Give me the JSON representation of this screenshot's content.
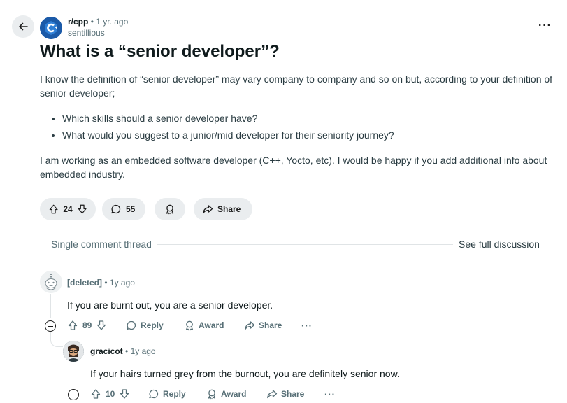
{
  "post": {
    "subreddit": "r/cpp",
    "age": "1 yr. ago",
    "separator": "•",
    "author": "sentillious",
    "subreddit_avatar_letter": "C",
    "title": "What is a “senior developer”?",
    "paragraph1": "I know the definition of “senior developer” may vary company to company and so on but, according to your definition of senior developer;",
    "bullets": [
      "Which skills should a senior developer have?",
      "What would you suggest to a junior/mid developer for their seniority journey?"
    ],
    "paragraph2": "I am working as an embedded software developer (C++, Yocto, etc). I would be happy if you add additional info about embedded industry.",
    "score": "24",
    "comment_count": "55",
    "share_label": "Share",
    "more_icon": "···"
  },
  "thread": {
    "label": "Single comment thread",
    "see_full": "See full discussion"
  },
  "comments": [
    {
      "author": "[deleted]",
      "age": "1y ago",
      "text": "If you are burnt out, you are a senior developer.",
      "score": "89",
      "reply_label": "Reply",
      "award_label": "Award",
      "share_label": "Share",
      "more_icon": "···"
    },
    {
      "author": "gracicot",
      "age": "1y ago",
      "text": "If your hairs turned grey from the burnout, you are definitely senior now.",
      "score": "10",
      "reply_label": "Reply",
      "award_label": "Award",
      "share_label": "Share",
      "more_icon": "···"
    }
  ],
  "separator": "•",
  "icons": {
    "back": "arrow-left-icon",
    "upvote": "upvote-arrow-icon",
    "downvote": "downvote-arrow-icon",
    "comment": "speech-bubble-icon",
    "award": "award-ribbon-icon",
    "share": "share-arrow-icon",
    "collapse": "collapse-minus-icon"
  },
  "colors": {
    "pill_bg": "#eaedef",
    "meta_text": "#576f76",
    "sub_avatar": "#1b5aa8"
  }
}
